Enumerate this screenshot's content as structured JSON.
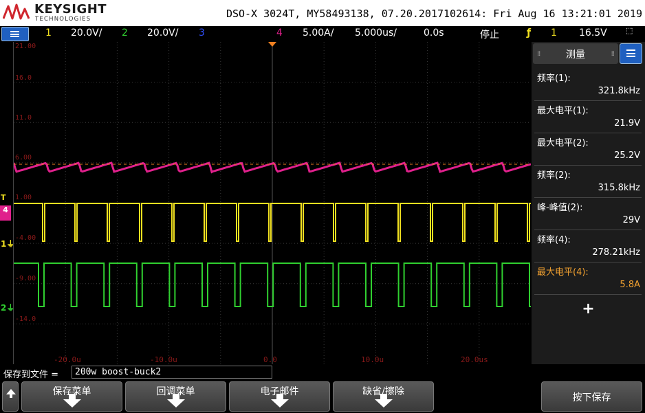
{
  "header": {
    "brand": "KEYSIGHT",
    "brand_sub": "TECHNOLOGIES",
    "device_info": "DSO-X 3024T, MY58493138, 07.20.2017102614: Fri Aug 16 13:21:01 2019"
  },
  "status": {
    "ch1_num": "1",
    "ch1_scale": "20.0V/",
    "ch2_num": "2",
    "ch2_scale": "20.0V/",
    "ch3_num": "3",
    "ch4_num": "4",
    "ch4_scale": "5.00A/",
    "timebase": "5.000us/",
    "delay": "0.0s",
    "run_state": "停止",
    "trig_source": "1",
    "trig_level": "16.5V"
  },
  "screen": {
    "y_labels": [
      "21.00",
      "16.0",
      "11.0",
      "6.00",
      "1.00",
      "-4.00",
      "-9.00",
      "-14.0"
    ],
    "t_labels": [
      "-20.0u",
      "-10.0u",
      "0.0",
      "10.0u",
      "20.0us"
    ],
    "colors": {
      "ch1": "#f0e020",
      "ch2": "#30d030",
      "ch4": "#e0208c",
      "grid": "#3a3a3a",
      "scale": "#8b1a1a"
    }
  },
  "panel": {
    "title": "测量",
    "measurements": [
      {
        "label": "频率(1):",
        "value": "321.8kHz",
        "color": "#ffffff"
      },
      {
        "label": "最大电平(1):",
        "value": "21.9V",
        "color": "#ffffff"
      },
      {
        "label": "最大电平(2):",
        "value": "25.2V",
        "color": "#ffffff"
      },
      {
        "label": "频率(2):",
        "value": "315.8kHz",
        "color": "#ffffff"
      },
      {
        "label": "峰-峰值(2):",
        "value": "29V",
        "color": "#ffffff"
      },
      {
        "label": "频率(4):",
        "value": "278.21kHz",
        "color": "#ffffff"
      },
      {
        "label": "最大电平(4):",
        "value": "5.8A",
        "color": "#f0a030"
      }
    ],
    "add_label": "+"
  },
  "save": {
    "label": "保存到文件 =",
    "filename": "200w boost-buck2"
  },
  "softkeys": {
    "k1": "保存菜单",
    "k2": "回调菜单",
    "k3": "电子邮件",
    "k4": "缺省/擦除",
    "k5": "按下保存"
  }
}
